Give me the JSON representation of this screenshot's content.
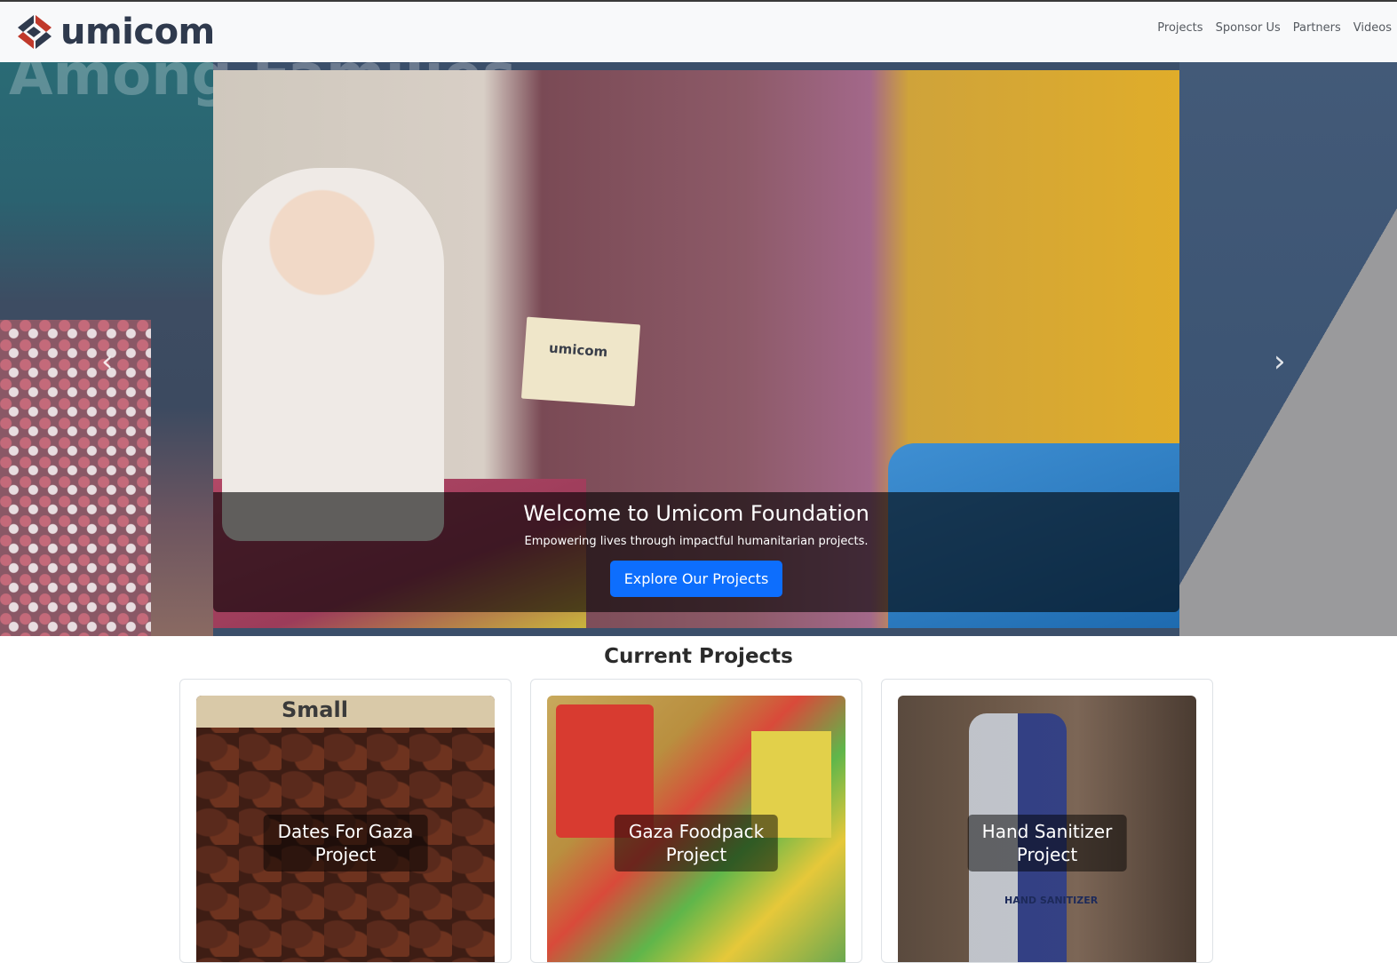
{
  "brand": {
    "name": "umicom",
    "logo_icon": "umicom-chevrons-logo",
    "colors": {
      "dark": "#2f3a4d",
      "red": "#c0392b"
    }
  },
  "nav": {
    "items": [
      "Projects",
      "Sponsor Us",
      "Partners",
      "Videos"
    ]
  },
  "hero": {
    "background_text": "Among Families",
    "slide_card_text": "umicom",
    "caption_title": "Welcome to Umicom Foundation",
    "caption_text": "Empowering lives through impactful humanitarian projects.",
    "cta_label": "Explore Our Projects",
    "cta_color": "#0d6efd",
    "prev_icon": "‹",
    "next_icon": "›"
  },
  "projects": {
    "title": "Current Projects",
    "items": [
      {
        "name": "Dates For Gaza Project",
        "line1": "Dates For Gaza",
        "line2": "Project",
        "image_text": "Small"
      },
      {
        "name": "Gaza Foodpack Project",
        "line1": "Gaza Foodpack",
        "line2": "Project"
      },
      {
        "name": "Hand Sanitizer Project",
        "line1": "Hand Sanitizer",
        "line2": "Project",
        "image_text": "HAND SANITIZER"
      }
    ]
  }
}
